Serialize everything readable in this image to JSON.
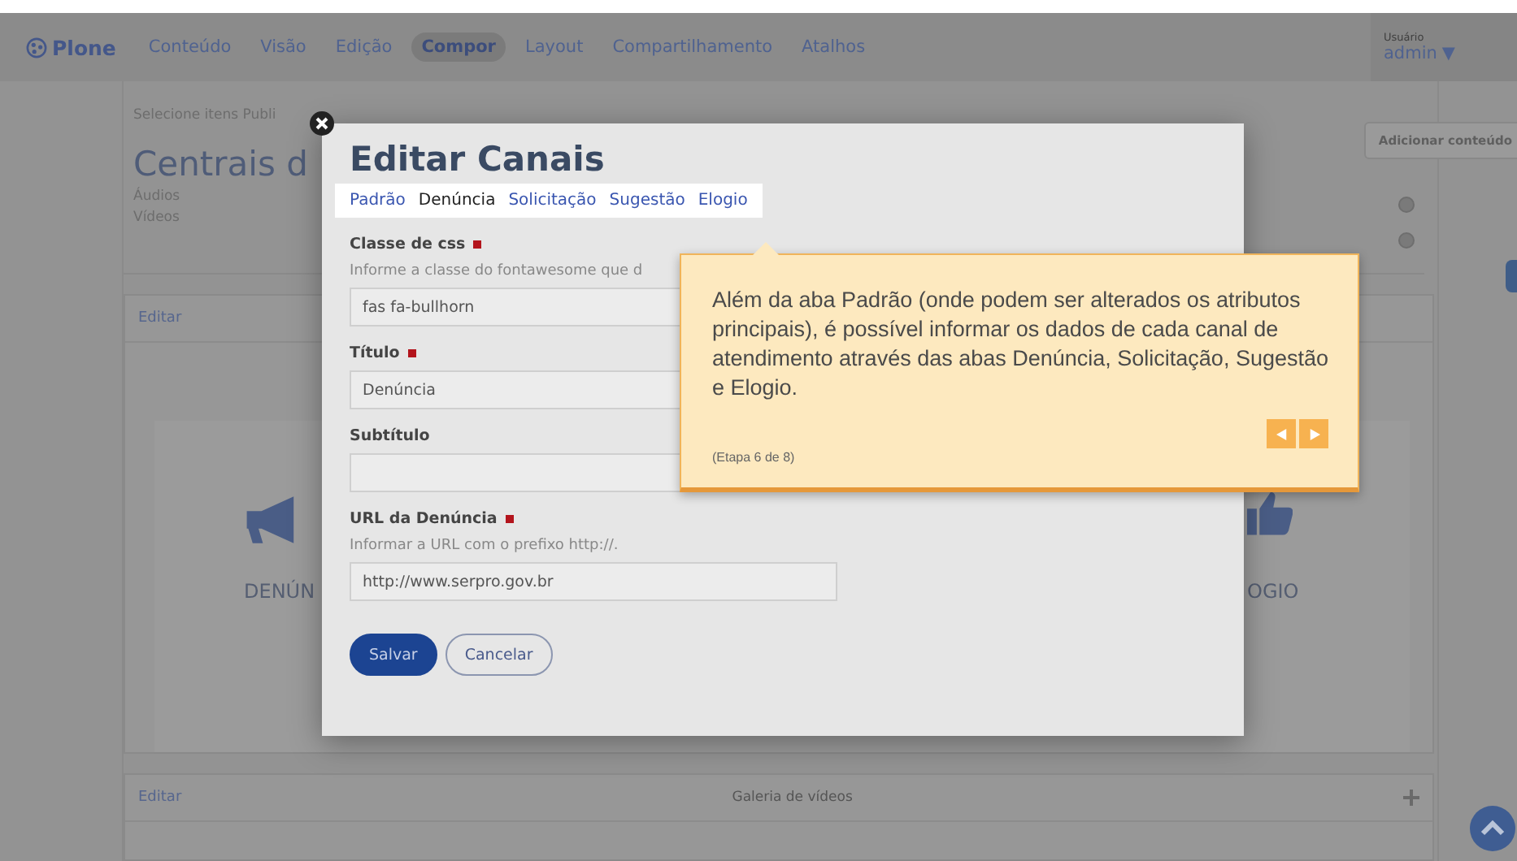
{
  "topbar": {
    "logo": "Plone",
    "nav": [
      {
        "label": "Conteúdo",
        "selected": false
      },
      {
        "label": "Visão",
        "selected": false
      },
      {
        "label": "Edição",
        "selected": false
      },
      {
        "label": "Compor",
        "selected": true
      },
      {
        "label": "Layout",
        "selected": false
      },
      {
        "label": "Compartilhamento",
        "selected": false
      },
      {
        "label": "Atalhos",
        "selected": false
      }
    ],
    "user": {
      "caption": "Usuário",
      "name": "admin",
      "caret": "▼"
    }
  },
  "page": {
    "breadcrumb": "Selecione itens Publi",
    "title": "Centrais d",
    "items": [
      "Áudios",
      "Vídeos"
    ],
    "add_button": "Adicionar conteúdo"
  },
  "channels_card": {
    "edit_link": "Editar",
    "channels": [
      {
        "label": "DENÚN",
        "kind": "megaphone"
      },
      {
        "label": "OGIO",
        "kind": "thumb"
      }
    ]
  },
  "video_card": {
    "edit_link": "Editar",
    "title": "Galeria de vídeos"
  },
  "modal": {
    "title": "Editar Canais",
    "tabs": [
      {
        "label": "Padrão",
        "selected": false
      },
      {
        "label": "Denúncia",
        "selected": true
      },
      {
        "label": "Solicitação",
        "selected": false
      },
      {
        "label": "Sugestão",
        "selected": false
      },
      {
        "label": "Elogio",
        "selected": false
      }
    ],
    "fields": [
      {
        "label": "Classe de css",
        "required": true,
        "help": "Informe a classe do fontawesome que d",
        "value": "fas fa-bullhorn"
      },
      {
        "label": "Título",
        "required": true,
        "value": "Denúncia"
      },
      {
        "label": "Subtítulo",
        "required": false
      },
      {
        "label": "URL da Denúncia",
        "required": true,
        "help": "Informar a URL com o prefixo http://.",
        "value": "http://www.serpro.gov.br"
      }
    ],
    "buttons": [
      {
        "label": "Salvar",
        "kind": "primary"
      },
      {
        "label": "Cancelar",
        "kind": "secondary"
      }
    ]
  },
  "tour": {
    "text": "Além da aba Padrão (onde podem ser alterados os atributos principais), é possível informar os dados de cada canal de atendimento através das abas Denúncia, Solicitação, Sugestão e Elogio.",
    "step": "(Etapa 6 de 8)"
  }
}
